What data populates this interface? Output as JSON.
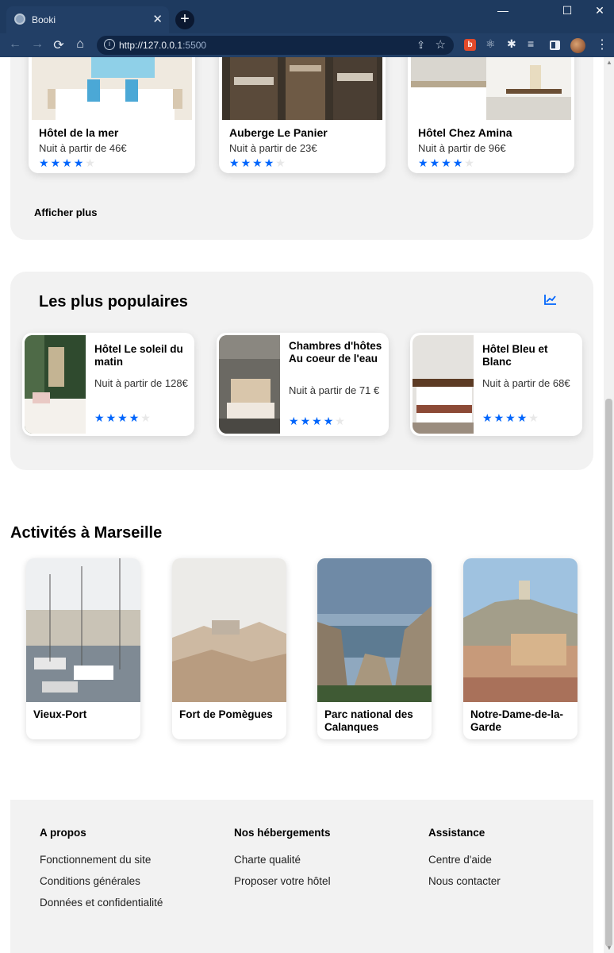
{
  "browser": {
    "tab_title": "Booki",
    "tab_close": "✕",
    "new_tab": "+",
    "url_host": "http://127.0.0.1",
    "url_port": ":5500",
    "window_controls": [
      "—",
      "☐",
      "✕"
    ],
    "ext_badge": "b"
  },
  "hotels": {
    "items": [
      {
        "name": "Hôtel de la mer",
        "price": "Nuit à partir de 46€",
        "rating": 4
      },
      {
        "name": "Auberge Le Panier",
        "price": "Nuit à partir de 23€",
        "rating": 4
      },
      {
        "name": "Hôtel Chez Amina",
        "price": "Nuit à partir de 96€",
        "rating": 4
      }
    ],
    "show_more": "Afficher plus"
  },
  "popular": {
    "title": "Les plus populaires",
    "icon": "chart-line-icon",
    "items": [
      {
        "name": "Hôtel Le soleil du matin",
        "price": "Nuit à partir de 128€",
        "rating": 4
      },
      {
        "name": "Chambres d'hôtes Au coeur de l'eau",
        "price": "Nuit à partir de 71 €",
        "rating": 4
      },
      {
        "name": "Hôtel Bleu et Blanc",
        "price": "Nuit à partir de 68€",
        "rating": 4
      }
    ]
  },
  "activities": {
    "title": "Activités à Marseille",
    "items": [
      {
        "name": "Vieux-Port"
      },
      {
        "name": "Fort de Pomègues"
      },
      {
        "name": "Parc national des Calanques"
      },
      {
        "name": "Notre-Dame-de-la-Garde"
      }
    ]
  },
  "footer": {
    "columns": [
      {
        "heading": "A propos",
        "links": [
          "Fonctionnement du site",
          "Conditions générales",
          "Données et confidentialité"
        ]
      },
      {
        "heading": "Nos hébergements",
        "links": [
          "Charte qualité",
          "Proposer votre hôtel"
        ]
      },
      {
        "heading": "Assistance",
        "links": [
          "Centre d'aide",
          "Nous contacter"
        ]
      }
    ]
  },
  "colors": {
    "accent": "#0065fc",
    "panel_bg": "#f2f2f2",
    "browser_frame": "#1e3a5f"
  }
}
